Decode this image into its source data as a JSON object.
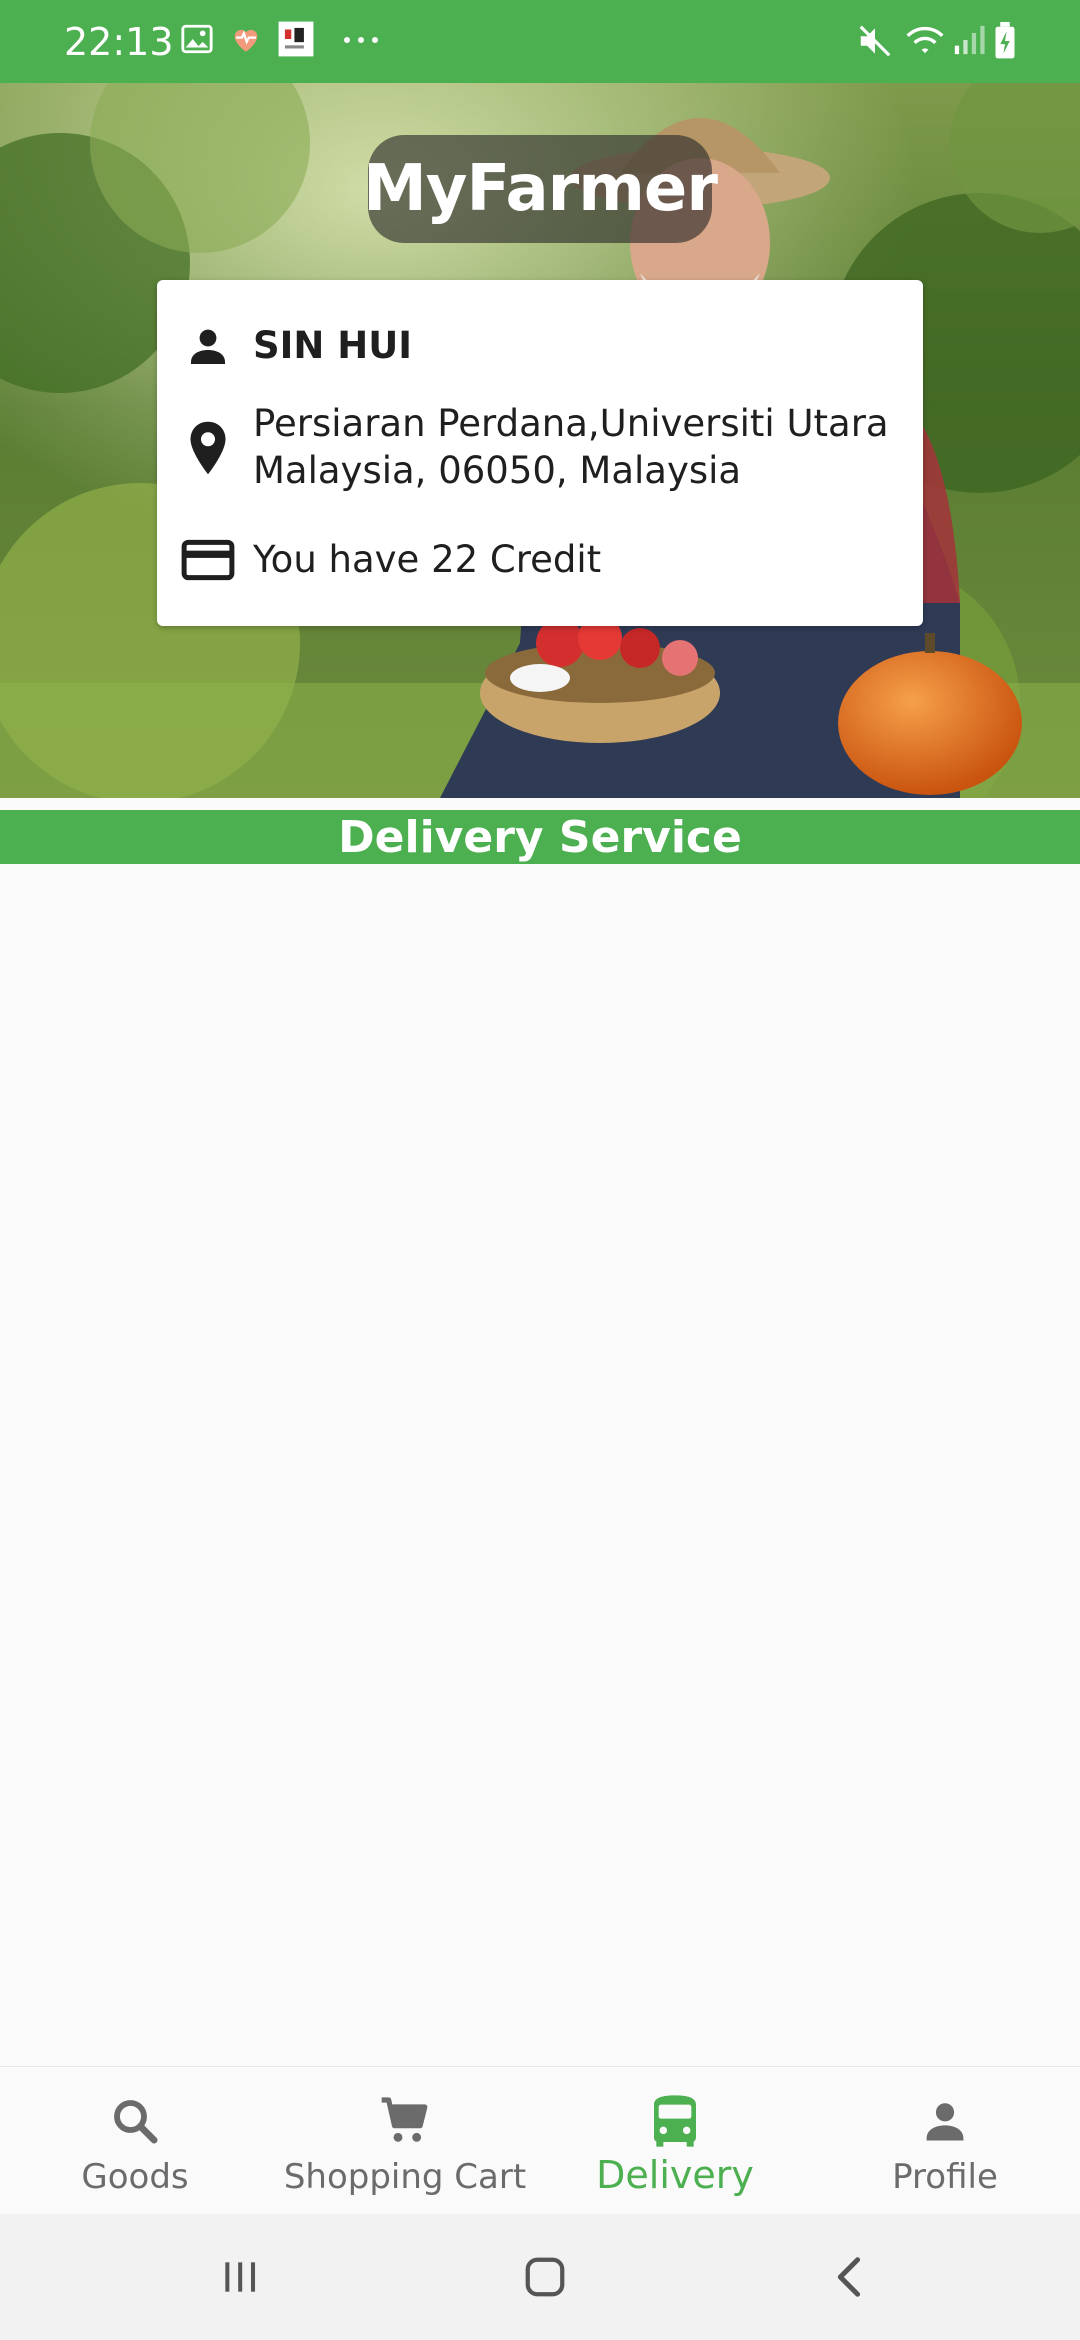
{
  "status_bar": {
    "time": "22:13",
    "icons_left": [
      "gallery-icon",
      "health-icon",
      "app-thumbnail-icon",
      "more-notifications-icon"
    ],
    "icons_right": [
      "mute-icon",
      "wifi-icon",
      "signal-icon",
      "battery-icon"
    ]
  },
  "header": {
    "app_title": "MyFarmer"
  },
  "profile_card": {
    "name": "SIN HUI",
    "address": "Persiaran Perdana,Universiti Utara Malaysia, 06050, Malaysia",
    "credit": "You have 22 Credit"
  },
  "section": {
    "title": "Delivery Service"
  },
  "bottom_nav": {
    "items": [
      {
        "label": "Goods",
        "icon": "search-icon",
        "active": false
      },
      {
        "label": "Shopping Cart",
        "icon": "cart-icon",
        "active": false
      },
      {
        "label": "Delivery",
        "icon": "bus-icon",
        "active": true
      },
      {
        "label": "Profile",
        "icon": "person-icon",
        "active": false
      }
    ]
  },
  "colors": {
    "primary": "#4caf50",
    "inactive": "#6b6b6b",
    "text_dark": "#1f1f1f"
  }
}
